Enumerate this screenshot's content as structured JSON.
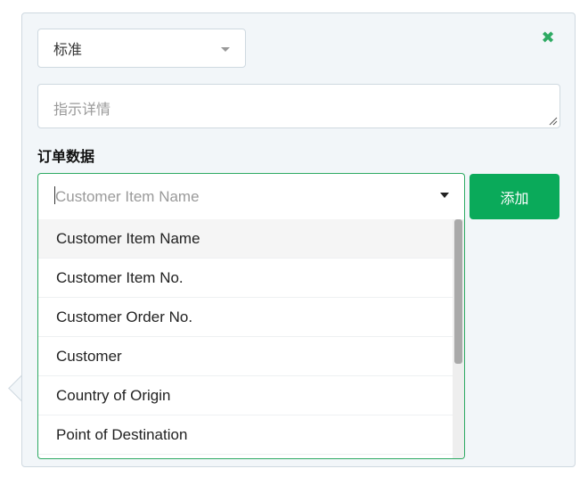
{
  "form": {
    "type_select_value": "标准",
    "details_placeholder": "指示详情",
    "section_label": "订单数据",
    "field_select_placeholder": "Customer Item Name",
    "add_button_label": "添加",
    "close_icon": "close-icon",
    "accent_color": "#0aaa5a"
  },
  "dropdown": {
    "options": [
      {
        "label": "Customer Item Name"
      },
      {
        "label": "Customer Item No."
      },
      {
        "label": "Customer Order No."
      },
      {
        "label": "Customer"
      },
      {
        "label": "Country of Origin"
      },
      {
        "label": "Point of Destination"
      }
    ]
  }
}
